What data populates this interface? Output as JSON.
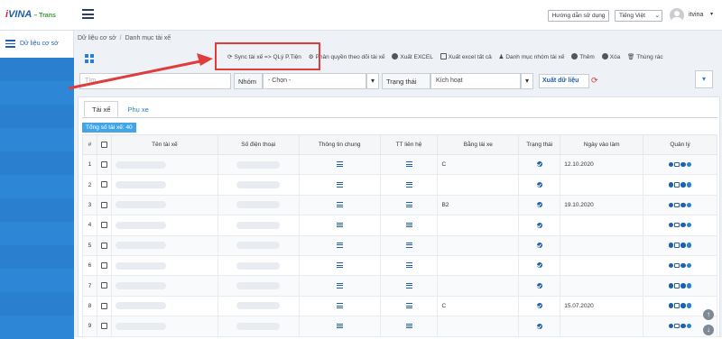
{
  "brand": {
    "part1": "i",
    "part2": "VINA",
    "suffix": "– Trans"
  },
  "header": {
    "guide_label": "Hướng dẫn sử dụng",
    "language": "Tiếng Việt",
    "user": "itvina"
  },
  "sidebar": {
    "active_label": "Dữ liệu cơ sở"
  },
  "breadcrumb": {
    "item1": "Dữ liệu cơ sở",
    "separator": "/",
    "item2": "Danh mục tài xế"
  },
  "toolbar": {
    "sync": "Sync tài xế => QLý P.Tiện",
    "permission": "Phân quyền theo dõi tài xế",
    "export_excel": "Xuất EXCEL",
    "export_all": "Xuất excel tất cả",
    "group_list": "Danh mục nhóm tài xế",
    "add": "Thêm",
    "delete": "Xóa",
    "trash": "Thùng rác"
  },
  "filters": {
    "search_placeholder": "Tìm...",
    "group_label": "Nhóm",
    "group_value": "- Chọn -",
    "status_label": "Trạng thái",
    "status_value": "Kích hoạt",
    "export_data": "Xuất dữ liệu"
  },
  "tabs": [
    {
      "label": "Tài xế"
    },
    {
      "label": "Phụ xe"
    }
  ],
  "count_badge": "Tổng số tài xế: 40",
  "table": {
    "headers": [
      "#",
      "",
      "Tên tài xế",
      "Số điện thoại",
      "Thông tin chung",
      "TT liên hệ",
      "Bằng lái xe",
      "Trạng thái",
      "Ngày vào làm",
      "Quản lý"
    ],
    "rows": [
      {
        "num": "1",
        "license": "C",
        "date": "12.10.2020"
      },
      {
        "num": "2",
        "license": "",
        "date": ""
      },
      {
        "num": "3",
        "license": "B2",
        "date": "19.10.2020"
      },
      {
        "num": "4",
        "license": "",
        "date": ""
      },
      {
        "num": "5",
        "license": "",
        "date": ""
      },
      {
        "num": "6",
        "license": "",
        "date": ""
      },
      {
        "num": "7",
        "license": "",
        "date": ""
      },
      {
        "num": "8",
        "license": "C",
        "date": "15.07.2020"
      },
      {
        "num": "9",
        "license": "",
        "date": ""
      }
    ]
  },
  "colors": {
    "accent": "#2a7fcf",
    "highlight": "#e03c3c",
    "brand_red": "#d6262b",
    "brand_blue": "#1f5fae"
  }
}
